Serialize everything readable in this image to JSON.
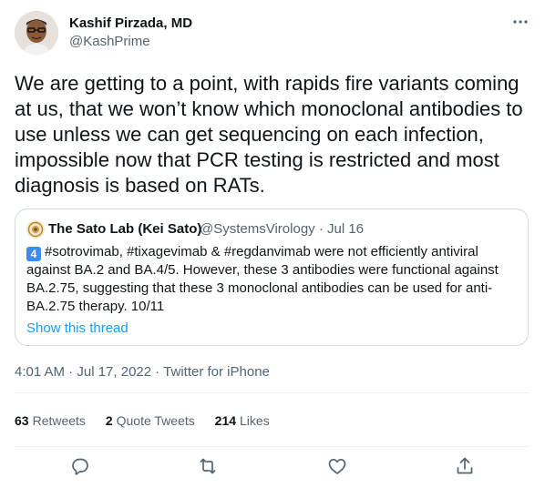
{
  "author": {
    "display_name": "Kashif Pirzada, MD",
    "handle": "@KashPrime"
  },
  "tweet": {
    "text": "We are getting to a point, with rapids fire variants coming at us, that we won’t know which monoclonal antibodies to use unless we can get sequencing on each infection, impossible now that PCR testing is restricted and most diagnosis is based on RATs."
  },
  "quote": {
    "display_name": "The Sato Lab (Kei Sato)",
    "meta": "@SystemsVirology · Jul 16",
    "keycap": "4",
    "text": "#sotrovimab, #tixagevimab & #regdanvimab were not efficiently antiviral against BA.2 and BA.4/5. However, these 3 antibodies were functional against BA.2.75, suggesting that these 3 monoclonal antibodies can be used for anti-BA.2.75 therapy. 10/11",
    "show_thread": "Show this thread"
  },
  "timestamp": "4:01 AM · Jul 17, 2022 · Twitter for iPhone",
  "stats": {
    "retweets_count": "63",
    "retweets_label": "Retweets",
    "quotes_count": "2",
    "quotes_label": "Quote Tweets",
    "likes_count": "214",
    "likes_label": "Likes"
  },
  "icons": {
    "more": "more-dots-icon",
    "reply": "reply-icon",
    "retweet": "retweet-icon",
    "like": "heart-icon",
    "share": "share-icon"
  },
  "colors": {
    "accent": "#1d9bf0",
    "text": "#0f1419",
    "secondary": "#536471",
    "border": "#cfd9de"
  }
}
